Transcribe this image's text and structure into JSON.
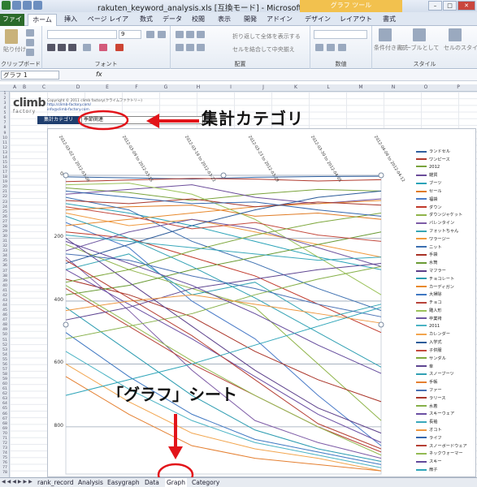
{
  "window": {
    "title": "rakuten_keyword_analysis.xls [互換モード] - Microsoft Excel",
    "context_tab": "グラフ ツール"
  },
  "tabs": [
    "ファイル",
    "ホーム",
    "挿入",
    "ページ レイアウト",
    "数式",
    "データ",
    "校閲",
    "表示",
    "開発",
    "アドイン",
    "デザイン",
    "レイアウト",
    "書式"
  ],
  "ribbon": {
    "clipboard": "クリップボード",
    "paste": "貼り付け",
    "font": "フォント",
    "font_size": "9",
    "alignment": "配置",
    "wrap": "折り返して全体を表示する",
    "merge": "セルを結合して中央揃え",
    "number": "数値",
    "style": "スタイル",
    "cond": "条件付き書式",
    "table": "テーブルとして書式設定",
    "cellstyle": "セルのスタイル"
  },
  "namebox": "グラフ 1",
  "formula": "fx",
  "columns": [
    "A",
    "B",
    "C",
    "D",
    "E",
    "F",
    "G",
    "H",
    "I",
    "J",
    "K",
    "L",
    "M",
    "N",
    "O",
    "P",
    "Q"
  ],
  "header_info": {
    "logo_main": "climb",
    "logo_sub": "factory",
    "copyright": "Copyright © 2011 climb factory(クライムファクトリー)",
    "url": "http://climb-factory.com/",
    "email": "info@climb-factory.com"
  },
  "category": {
    "label": "集計カテゴリ",
    "value": "季節関連"
  },
  "annotations": {
    "category_note": "集計カテゴリ",
    "sheet_note": "「グラフ」シート"
  },
  "sheet_tabs": [
    "rank_record",
    "Analysis",
    "Easygraph",
    "Data",
    "Graph",
    "Category"
  ],
  "active_sheet": "Graph",
  "chart_data": {
    "type": "line",
    "x": [
      "2012-03-02 to 2012-03-08",
      "2012-03-09 to 2012-03-15",
      "2012-03-16 to 2012-03-22",
      "2012-03-23 to 2012-03-29",
      "2012-03-30 to 2012-04-05",
      "2012-04-06 to 2012-04-12"
    ],
    "yticks": [
      0,
      200,
      400,
      600,
      800
    ],
    "ylim": [
      0,
      950
    ],
    "y_reversed": true,
    "grid": true,
    "legend_position": "right",
    "series": [
      {
        "name": "ランドセル",
        "color": "#2f5f9e",
        "values": [
          5,
          8,
          12,
          6,
          4,
          3
        ]
      },
      {
        "name": "ワンピース",
        "color": "#b03a2e",
        "values": [
          20,
          15,
          10,
          12,
          18,
          14
        ]
      },
      {
        "name": "2012",
        "color": "#7aa33c",
        "values": [
          40,
          55,
          80,
          60,
          45,
          50
        ]
      },
      {
        "name": "雑貨",
        "color": "#6b4c9a",
        "values": [
          60,
          45,
          30,
          70,
          90,
          75
        ]
      },
      {
        "name": "ブーツ",
        "color": "#2aa3b8",
        "values": [
          90,
          120,
          160,
          210,
          260,
          300
        ]
      },
      {
        "name": "セール",
        "color": "#e07b24",
        "values": [
          110,
          100,
          95,
          130,
          120,
          140
        ]
      },
      {
        "name": "福袋",
        "color": "#4a7bc8",
        "values": [
          150,
          230,
          400,
          520,
          700,
          860
        ]
      },
      {
        "name": "ダウン",
        "color": "#c0392b",
        "values": [
          180,
          200,
          260,
          320,
          410,
          500
        ]
      },
      {
        "name": "ダウンジャケット",
        "color": "#8fb44a",
        "values": [
          220,
          300,
          360,
          420,
          600,
          780
        ]
      },
      {
        "name": "バレンタイン",
        "color": "#7d5ba6",
        "values": [
          260,
          430,
          620,
          780,
          850,
          900
        ]
      },
      {
        "name": "フォットちゃん",
        "color": "#37a6b5",
        "values": [
          300,
          250,
          380,
          340,
          460,
          410
        ]
      },
      {
        "name": "ワラージー",
        "color": "#f09a3e",
        "values": [
          120,
          160,
          140,
          180,
          220,
          260
        ]
      },
      {
        "name": "ニット",
        "color": "#3c6fb0",
        "values": [
          70,
          110,
          210,
          280,
          360,
          430
        ]
      },
      {
        "name": "手袋",
        "color": "#a93226",
        "values": [
          330,
          380,
          450,
          560,
          650,
          720
        ]
      },
      {
        "name": "水筒",
        "color": "#6a9b34",
        "values": [
          380,
          350,
          300,
          260,
          220,
          180
        ]
      },
      {
        "name": "マフラー",
        "color": "#5b3f8a",
        "values": [
          200,
          340,
          480,
          620,
          740,
          820
        ]
      },
      {
        "name": "チョコレート",
        "color": "#2b9bb0",
        "values": [
          420,
          560,
          700,
          810,
          870,
          910
        ]
      },
      {
        "name": "カーディガン",
        "color": "#e8892c",
        "values": [
          160,
          140,
          120,
          100,
          90,
          80
        ]
      },
      {
        "name": "大掃除",
        "color": "#3f78c2",
        "values": [
          500,
          640,
          760,
          840,
          880,
          920
        ]
      },
      {
        "name": "チョコ",
        "color": "#b8433a",
        "values": [
          360,
          480,
          600,
          700,
          800,
          880
        ]
      },
      {
        "name": "雛人形",
        "color": "#9bc25a",
        "values": [
          30,
          25,
          60,
          140,
          260,
          380
        ]
      },
      {
        "name": "卒業袴",
        "color": "#6e56a0",
        "values": [
          240,
          180,
          140,
          170,
          230,
          290
        ]
      },
      {
        "name": "2011",
        "color": "#4ab3c4",
        "values": [
          560,
          680,
          780,
          850,
          890,
          930
        ]
      },
      {
        "name": "カレンダー",
        "color": "#f2a54e",
        "values": [
          600,
          720,
          820,
          870,
          900,
          940
        ]
      },
      {
        "name": "入学式",
        "color": "#2d5c9a",
        "values": [
          280,
          220,
          160,
          110,
          70,
          50
        ]
      },
      {
        "name": "子供服",
        "color": "#c44a3e",
        "values": [
          100,
          130,
          170,
          150,
          190,
          210
        ]
      },
      {
        "name": "サンダル",
        "color": "#7fa83e",
        "values": [
          340,
          300,
          240,
          190,
          150,
          120
        ]
      },
      {
        "name": "傘",
        "color": "#5e4591",
        "values": [
          460,
          420,
          360,
          330,
          300,
          280
        ]
      },
      {
        "name": "スノーブーツ",
        "color": "#31a0b3",
        "values": [
          130,
          200,
          290,
          390,
          500,
          610
        ]
      },
      {
        "name": "手帳",
        "color": "#e47f30",
        "values": [
          640,
          760,
          860,
          900,
          920,
          940
        ]
      },
      {
        "name": "ファー",
        "color": "#4870b4",
        "values": [
          250,
          270,
          320,
          360,
          410,
          450
        ]
      },
      {
        "name": "ラリース",
        "color": "#a8372c",
        "values": [
          80,
          90,
          75,
          100,
          85,
          95
        ]
      },
      {
        "name": "水着",
        "color": "#86b049",
        "values": [
          520,
          480,
          440,
          380,
          330,
          290
        ]
      },
      {
        "name": "スキーウェア",
        "color": "#6b4fa3",
        "values": [
          300,
          410,
          520,
          640,
          760,
          850
        ]
      },
      {
        "name": "長袖",
        "color": "#3aa8bb",
        "values": [
          190,
          210,
          230,
          250,
          270,
          260
        ]
      },
      {
        "name": "オコト",
        "color": "#ee9740",
        "values": [
          430,
          400,
          380,
          410,
          440,
          470
        ]
      },
      {
        "name": "ライフ",
        "color": "#3567ad",
        "values": [
          50,
          70,
          90,
          85,
          110,
          130
        ]
      },
      {
        "name": "スノーボードウェア",
        "color": "#b64035",
        "values": [
          270,
          390,
          510,
          650,
          790,
          870
        ]
      },
      {
        "name": "ネックウォーマー",
        "color": "#93ba52",
        "values": [
          350,
          470,
          590,
          700,
          800,
          890
        ]
      },
      {
        "name": "スキー",
        "color": "#62499b",
        "values": [
          210,
          280,
          350,
          440,
          540,
          630
        ]
      },
      {
        "name": "扇子",
        "color": "#2fa5b9",
        "values": [
          700,
          650,
          600,
          540,
          480,
          420
        ]
      }
    ]
  }
}
